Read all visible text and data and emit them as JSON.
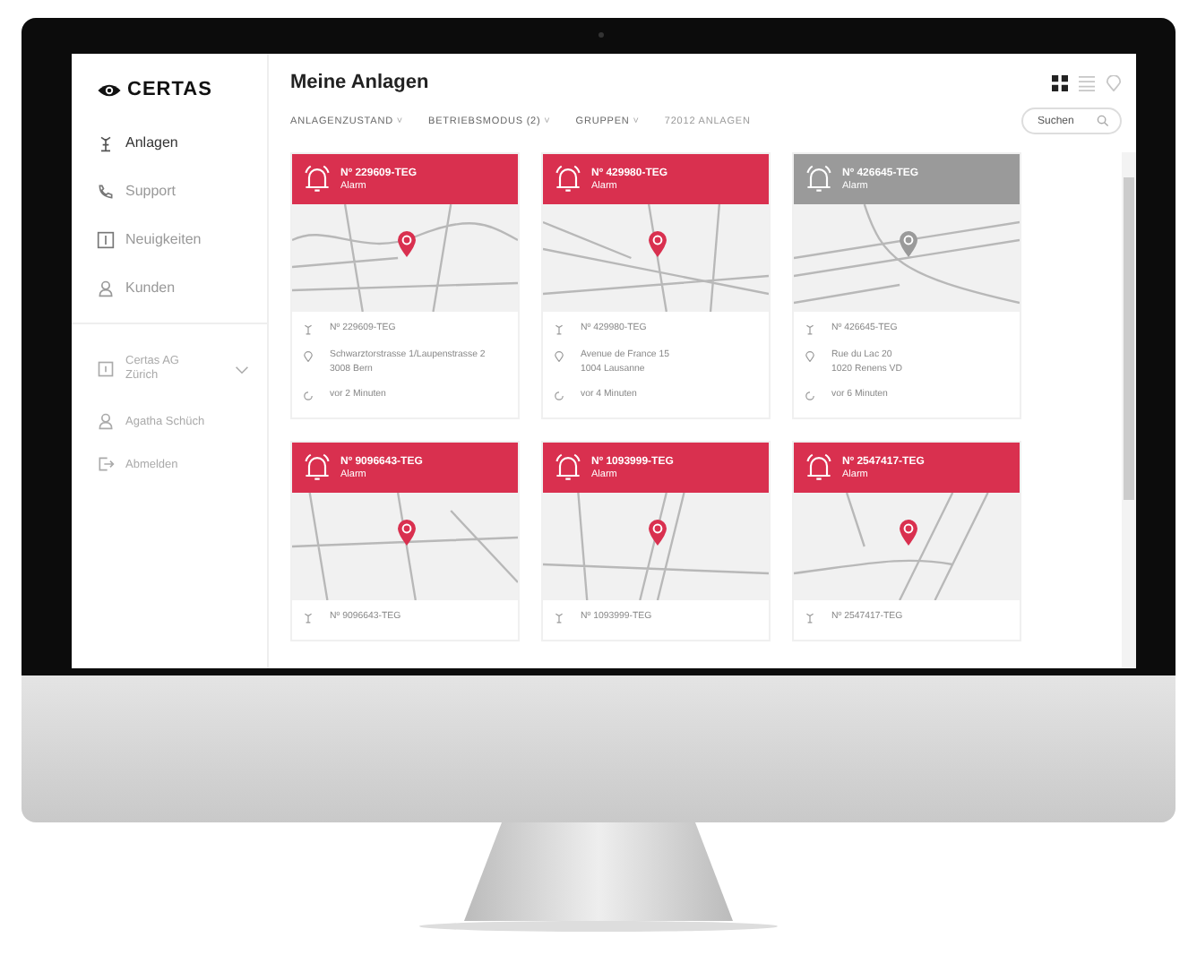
{
  "sidebar": {
    "logo": "CERTAS",
    "nav": [
      {
        "label": "Anlagen",
        "selected": true
      },
      {
        "label": "Support",
        "selected": false
      },
      {
        "label": "Neuigkeiten",
        "selected": false
      },
      {
        "label": "Kunden",
        "selected": false
      }
    ],
    "company": {
      "lines": [
        "Certas AG",
        "Zürich"
      ],
      "expanded": false
    },
    "user": "Agatha Schüch",
    "logout": "Abmelden"
  },
  "header": {
    "title": "Meine Anlagen",
    "views": [
      {
        "selected": true
      },
      {
        "selected": false
      },
      {
        "selected": false
      }
    ]
  },
  "filters": [
    {
      "label": "ANLAGENZUSTAND",
      "caret": "˅"
    },
    {
      "label": "BETRIEBSMODUS (2)",
      "caret": "˅"
    },
    {
      "label": "GRUPPEN",
      "caret": "˅"
    }
  ],
  "count": "72012 ANLAGEN",
  "search": {
    "placeholder": "Suchen"
  },
  "cards": [
    {
      "title": "Nº 229609-TEG",
      "status": "Alarm",
      "color": "#d9304f",
      "info": [
        {
          "kind": "id",
          "lines": [
            "Nº 229609-TEG"
          ]
        },
        {
          "kind": "address",
          "lines": [
            "Schwarztorstrasse 1/Laupenstrasse 2",
            "3008 Bern"
          ]
        },
        {
          "kind": "time",
          "lines": [
            "vor 2 Minuten"
          ]
        }
      ]
    },
    {
      "title": "Nº 429980-TEG",
      "status": "Alarm",
      "color": "#d9304f",
      "info": [
        {
          "kind": "id",
          "lines": [
            "Nº 429980-TEG"
          ]
        },
        {
          "kind": "address",
          "lines": [
            "Avenue de France 15",
            "1004 Lausanne"
          ]
        },
        {
          "kind": "time",
          "lines": [
            "vor 4 Minuten"
          ]
        }
      ]
    },
    {
      "title": "Nº 426645-TEG",
      "status": "Alarm",
      "color": "#9a9a9a",
      "info": [
        {
          "kind": "id",
          "lines": [
            "Nº 426645-TEG"
          ]
        },
        {
          "kind": "address",
          "lines": [
            "Rue du Lac 20",
            "1020 Renens VD"
          ]
        },
        {
          "kind": "time",
          "lines": [
            "vor 6 Minuten"
          ]
        }
      ]
    },
    {
      "title": "Nº 9096643-TEG",
      "status": "Alarm",
      "color": "#d9304f",
      "info": [
        {
          "kind": "id",
          "lines": [
            "Nº 9096643-TEG"
          ]
        }
      ]
    },
    {
      "title": "Nº 1093999-TEG",
      "status": "Alarm",
      "color": "#d9304f",
      "info": [
        {
          "kind": "id",
          "lines": [
            "Nº 1093999-TEG"
          ]
        }
      ]
    },
    {
      "title": "Nº 2547417-TEG",
      "status": "Alarm",
      "color": "#d9304f",
      "info": [
        {
          "kind": "id",
          "lines": [
            "Nº 2547417-TEG"
          ]
        }
      ]
    }
  ]
}
